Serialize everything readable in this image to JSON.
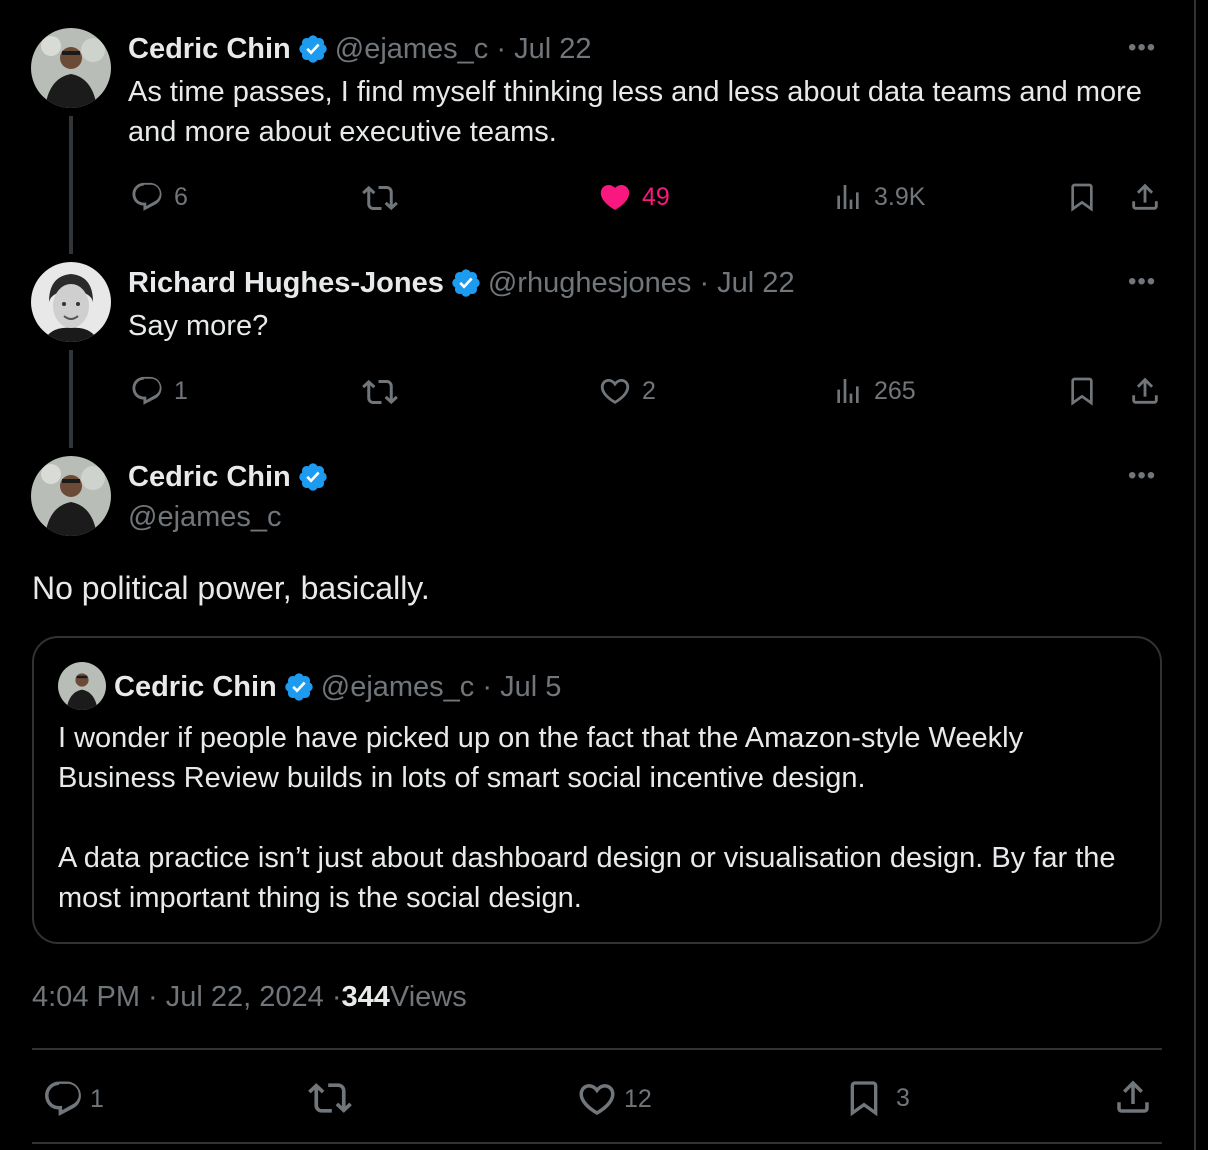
{
  "tweet1": {
    "name": "Cedric Chin",
    "handle_date": "@ejames_c · Jul 22",
    "text": "As time passes, I find myself thinking less and less about data teams and more and more about executive teams.",
    "replies": "6",
    "likes": "49",
    "views": "3.9K"
  },
  "tweet2": {
    "name": "Richard Hughes-Jones",
    "handle_date": "@rhughesjones · Jul 22",
    "text": "Say more?",
    "replies": "1",
    "likes": "2",
    "views": "265"
  },
  "main": {
    "name": "Cedric Chin",
    "handle": "@ejames_c",
    "text": "No political power, basically.",
    "quote": {
      "name": "Cedric Chin",
      "handle_date": "@ejames_c · Jul 5",
      "para1": "I wonder if people have picked up on the fact that the Amazon-style Weekly Business Review builds in lots of smart social incentive design.",
      "para2": "A data practice isn’t just about dashboard design or visualisation design. By far the most important thing is the social design."
    },
    "timestamp": "4:04 PM · Jul 22, 2024 · ",
    "views_count": "344",
    "views_label": " Views",
    "replies": "1",
    "likes": "12",
    "bookmarks": "3"
  },
  "more_label": "•••",
  "colors": {
    "like_active": "#f91880",
    "verified": "#1d9bf0",
    "muted": "#71767b"
  },
  "icons": [
    "reply-icon",
    "retweet-icon",
    "like-icon",
    "views-icon",
    "bookmark-icon",
    "share-icon",
    "verified-badge-icon",
    "more-icon"
  ]
}
